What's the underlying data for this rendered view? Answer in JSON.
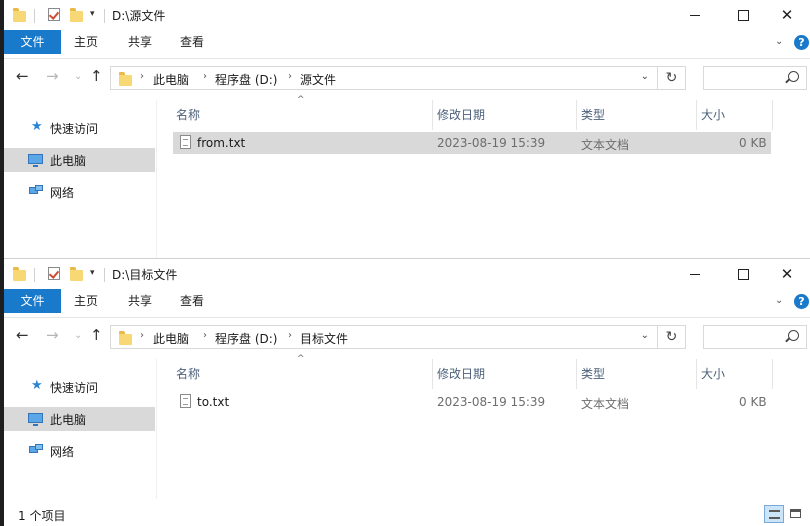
{
  "windows": [
    {
      "title": "D:\\源文件",
      "tabs": {
        "file": "文件",
        "home": "主页",
        "share": "共享",
        "view": "查看"
      },
      "help": "?",
      "breadcrumb": [
        "此电脑",
        "程序盘 (D:)",
        "源文件"
      ],
      "search_placeholder": "",
      "nav": {
        "quick_access": "快速访问",
        "this_pc": "此电脑",
        "network": "网络"
      },
      "columns": {
        "name": "名称",
        "modified": "修改日期",
        "type": "类型",
        "size": "大小"
      },
      "files": [
        {
          "name": "from.txt",
          "modified": "2023-08-19 15:39",
          "type": "文本文档",
          "size": "0 KB"
        }
      ]
    },
    {
      "title": "D:\\目标文件",
      "tabs": {
        "file": "文件",
        "home": "主页",
        "share": "共享",
        "view": "查看"
      },
      "help": "?",
      "breadcrumb": [
        "此电脑",
        "程序盘 (D:)",
        "目标文件"
      ],
      "search_placeholder": "",
      "nav": {
        "quick_access": "快速访问",
        "this_pc": "此电脑",
        "network": "网络"
      },
      "columns": {
        "name": "名称",
        "modified": "修改日期",
        "type": "类型",
        "size": "大小"
      },
      "files": [
        {
          "name": "to.txt",
          "modified": "2023-08-19 15:39",
          "type": "文本文档",
          "size": "0 KB"
        }
      ],
      "status": "1 个项目"
    }
  ],
  "colors": {
    "accent": "#1979ca",
    "selection": "#d9d9d9",
    "header_text": "#4c607a"
  }
}
